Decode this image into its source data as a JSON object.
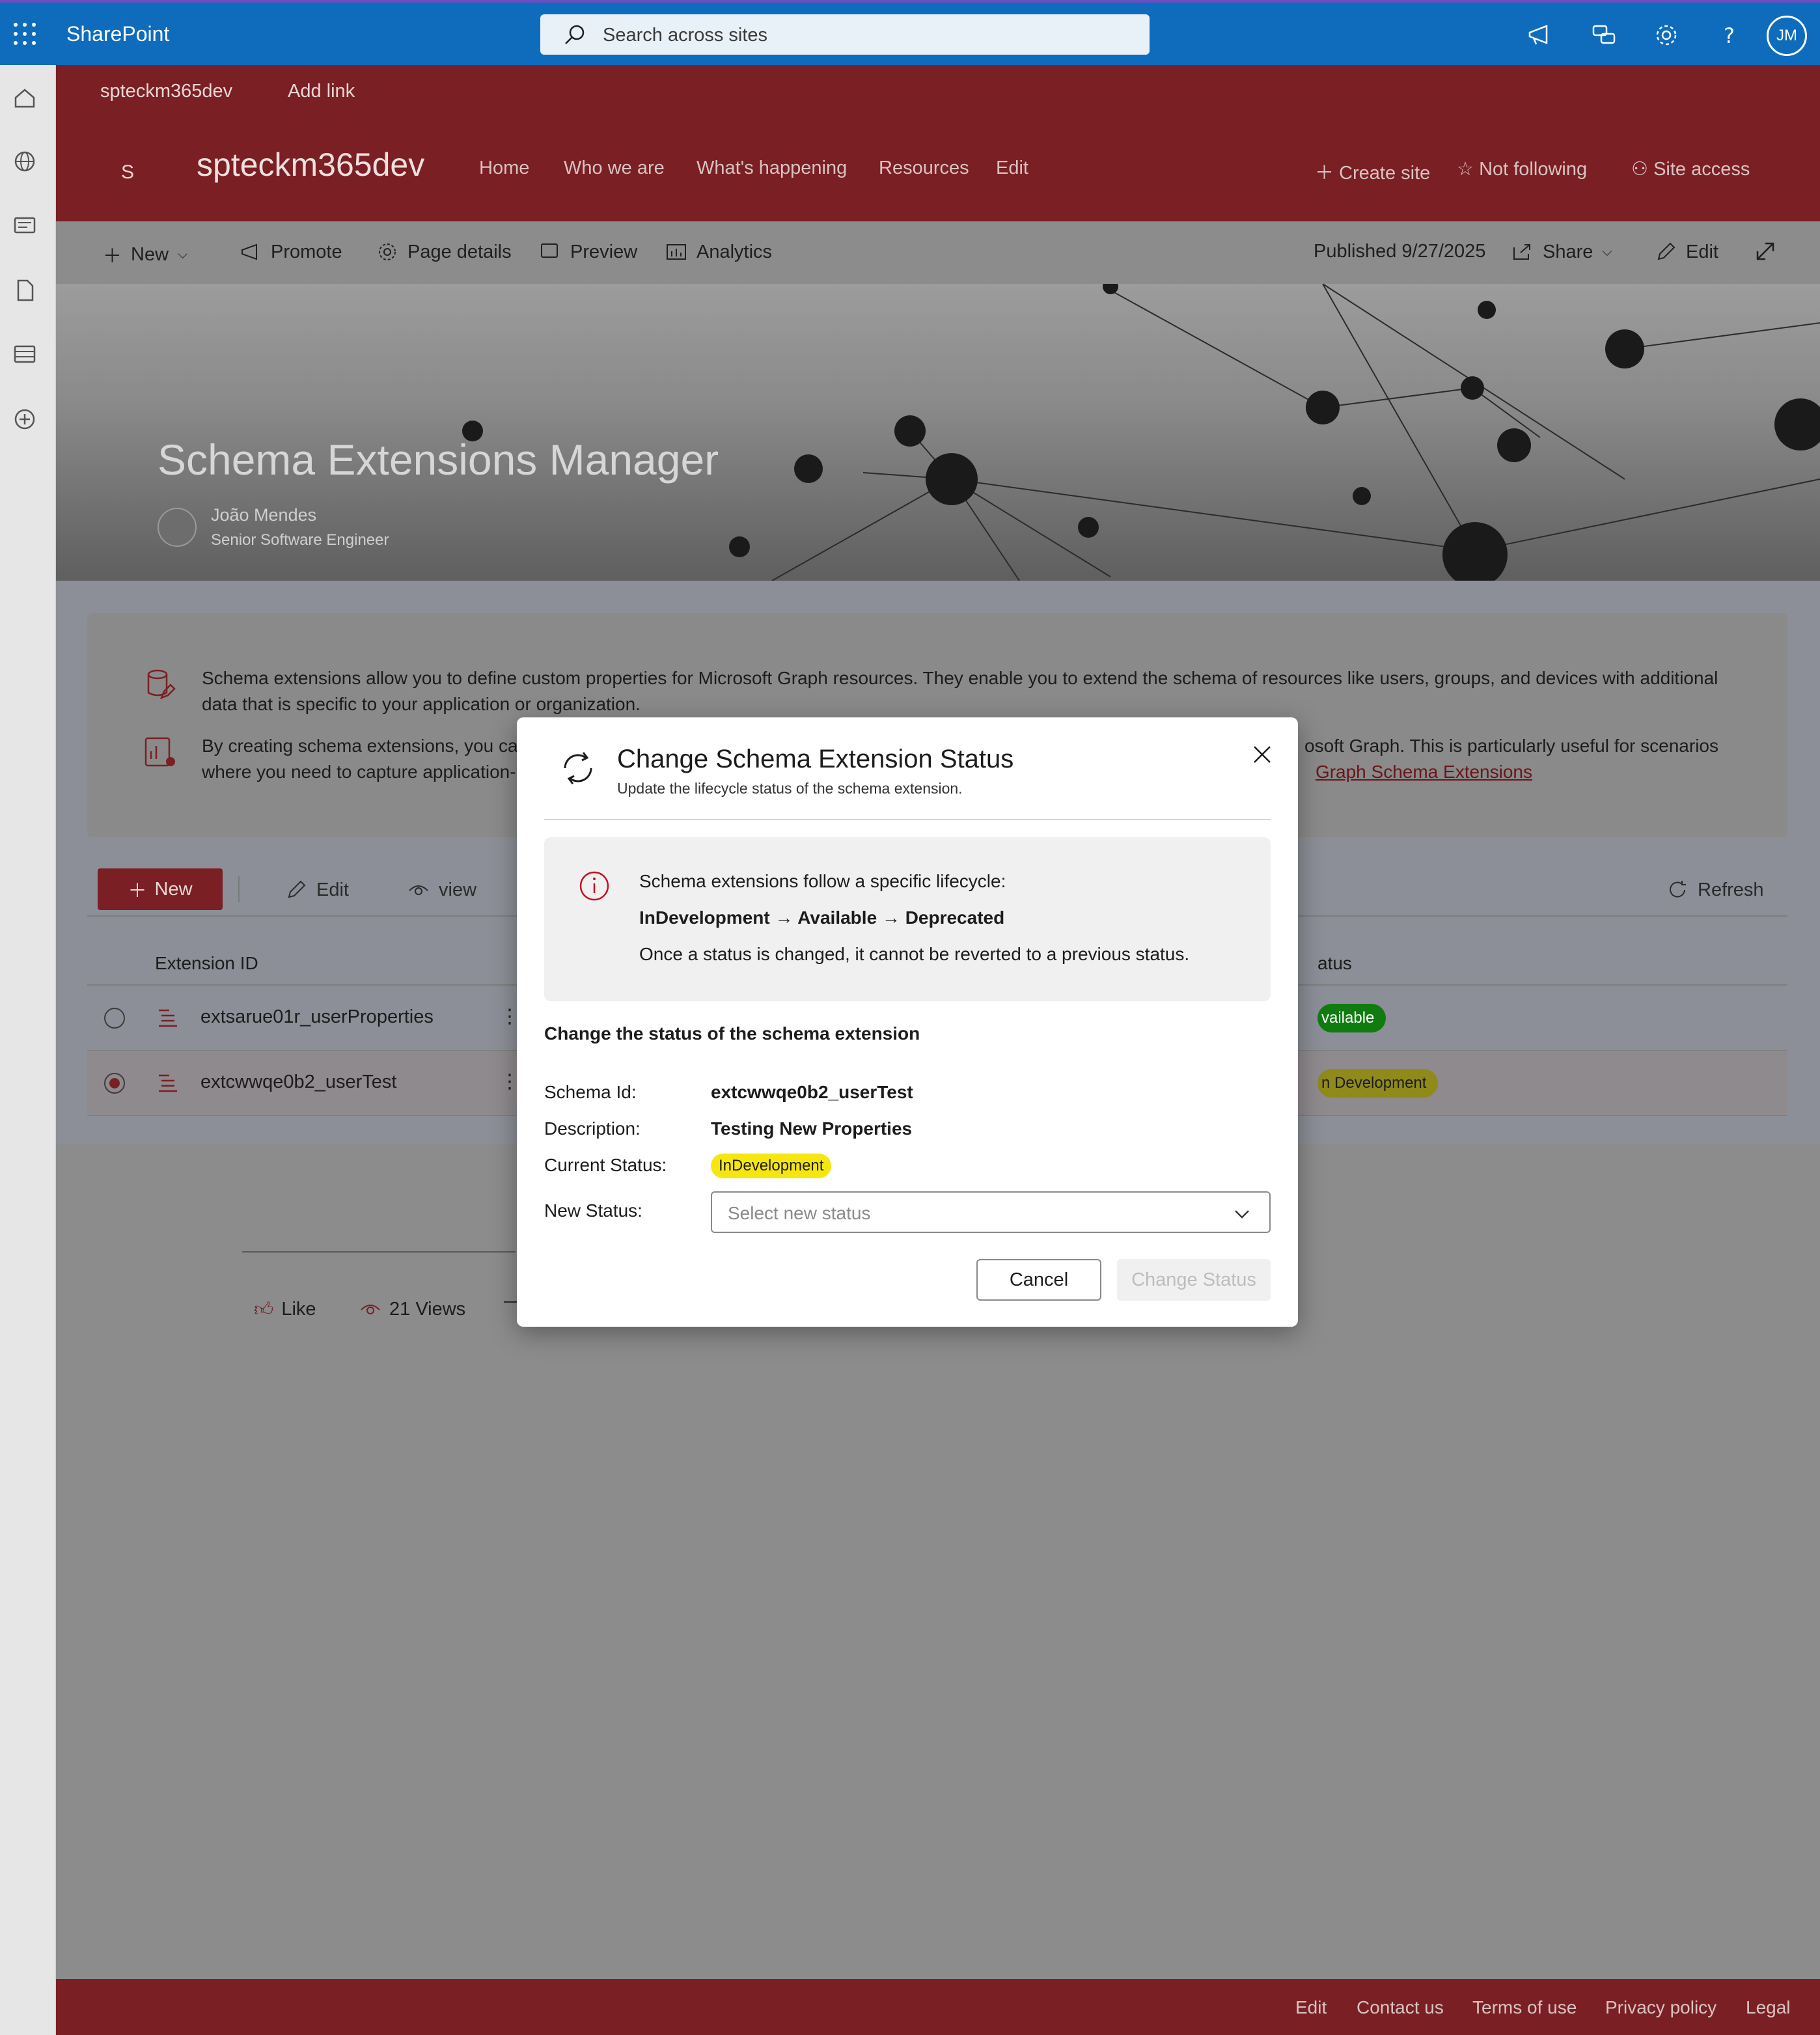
{
  "suite": {
    "app_name": "SharePoint",
    "search_placeholder": "Search across sites",
    "avatar_initials": "JM"
  },
  "hub_nav": {
    "site": "spteckm365dev",
    "add_link": "Add link"
  },
  "site_header": {
    "logo_letter": "S",
    "title": "spteckm365dev",
    "nav": [
      "Home",
      "Who we are",
      "What's happening",
      "Resources",
      "Edit"
    ],
    "create_site": "Create site",
    "follow": "Not following",
    "site_access": "Site access"
  },
  "command_bar": {
    "new": "New",
    "promote": "Promote",
    "page_details": "Page details",
    "preview": "Preview",
    "analytics": "Analytics",
    "published": "Published 9/27/2025",
    "share": "Share",
    "edit": "Edit"
  },
  "hero": {
    "title": "Schema Extensions Manager",
    "author": "João Mendes",
    "role": "Senior Software Engineer"
  },
  "info": {
    "p1_line1": "Schema extensions allow you to define custom properties for Microsoft Graph resources. They enable you to extend the schema of resources like users, groups, and devices with additional",
    "p1_line2": "data that is specific to your application or organization.",
    "p2_left_line1": "By creating schema extensions, you car",
    "p2_left_line2": "where you need to capture application-",
    "p2_right_line1": "osoft Graph. This is particularly useful for scenarios",
    "p2_right_link": "Graph Schema Extensions"
  },
  "toolbar": {
    "new": "New",
    "edit": "Edit",
    "view": "view",
    "refresh": "Refresh"
  },
  "table": {
    "col_id": "Extension ID",
    "col_status": "atus",
    "rows": [
      {
        "id": "extsarue01r_userProperties",
        "status": "vailable",
        "selected": false
      },
      {
        "id": "extcwwqe0b2_userTest",
        "status": "n Development",
        "selected": true
      }
    ]
  },
  "social": {
    "like": "Like",
    "views": "21 Views"
  },
  "footer": {
    "links": [
      "Edit",
      "Contact us",
      "Terms of use",
      "Privacy policy",
      "Legal"
    ]
  },
  "dialog": {
    "title": "Change Schema Extension Status",
    "subtitle": "Update the lifecycle status of the schema extension.",
    "info_line1": "Schema extensions follow a specific lifecycle:",
    "lifecycle": "InDevelopment → Available → Deprecated",
    "info_line3": "Once a status is changed, it cannot be reverted to a previous status.",
    "section": "Change the status of the schema extension",
    "schema_id_label": "Schema Id:",
    "schema_id": "extcwwqe0b2_userTest",
    "description_label": "Description:",
    "description": "Testing New Properties",
    "current_status_label": "Current Status:",
    "current_status": "InDevelopment",
    "new_status_label": "New Status:",
    "new_status_placeholder": "Select new status",
    "cancel": "Cancel",
    "change": "Change Status"
  },
  "colors": {
    "brand_blue": "#0f6cbd",
    "theme_red": "#7a1f23",
    "badge_yellow": "#f5e60f",
    "badge_green": "#107c10"
  }
}
